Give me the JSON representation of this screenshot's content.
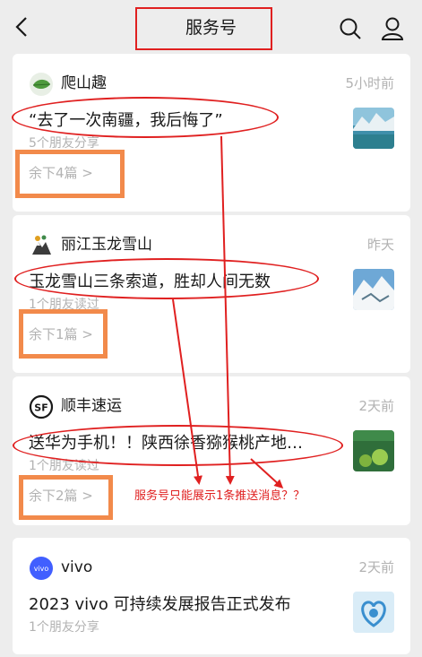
{
  "header": {
    "title": "服务号"
  },
  "cards": [
    {
      "account": "爬山趣",
      "time": "5小时前",
      "title": "“去了一次南疆，我后悔了”",
      "meta": "5个朋友分享",
      "more": "余下4篇 >",
      "icon": "leaf-logo-icon"
    },
    {
      "account": "丽江玉龙雪山",
      "time": "昨天",
      "title": "玉龙雪山三条索道，胜却人间无数",
      "meta": "1个朋友读过",
      "more": "余下1篇 >",
      "icon": "mountain-logo-icon"
    },
    {
      "account": "顺丰速运",
      "time": "2天前",
      "title": "送华为手机！！陕西徐香猕猴桃产地…",
      "meta": "1个朋友读过",
      "more": "余下2篇 >",
      "icon": "sf-logo-icon"
    },
    {
      "account": "vivo",
      "time": "2天前",
      "title": "2023 vivo 可持续发展报告正式发布",
      "meta": "1个朋友分享",
      "icon": "vivo-logo-icon"
    }
  ],
  "annotation": {
    "text": "服务号只能展示1条推送消息？？",
    "color": "#e02020",
    "box_color": "#f28a4b"
  },
  "colors": {
    "background": "#ededed",
    "card": "#ffffff",
    "secondary_text": "#b2b2b2"
  }
}
